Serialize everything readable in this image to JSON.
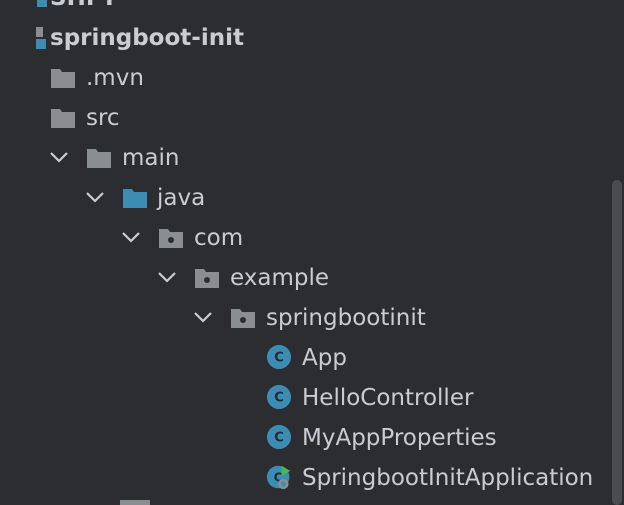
{
  "tree": {
    "partial_top": "SHFT",
    "project": "springboot-init",
    "items": [
      {
        "label": ".mvn",
        "type": "folder"
      },
      {
        "label": "src",
        "type": "folder"
      },
      {
        "label": "main",
        "type": "folder"
      },
      {
        "label": "java",
        "type": "source-folder"
      },
      {
        "label": "com",
        "type": "package"
      },
      {
        "label": "example",
        "type": "package"
      },
      {
        "label": "springbootinit",
        "type": "package"
      },
      {
        "label": "App",
        "type": "class"
      },
      {
        "label": "HelloController",
        "type": "class"
      },
      {
        "label": "MyAppProperties",
        "type": "class"
      },
      {
        "label": "SpringbootInitApplication",
        "type": "spring-boot-class"
      }
    ]
  },
  "icons": {
    "module": "module-icon",
    "folder": "folder-icon",
    "source_folder": "source-folder-icon",
    "package": "package-icon",
    "class": "class-icon",
    "spring_boot_class": "spring-boot-class-icon",
    "expand": "chevron-down-icon",
    "class_letter": "C"
  },
  "colors": {
    "background": "#2b2d30",
    "text": "#c9cdd2",
    "folder": "#8a8d92",
    "source_folder": "#3d8cb3",
    "class_circle": "#3d8cb3",
    "run_arrow": "#4db84d"
  }
}
